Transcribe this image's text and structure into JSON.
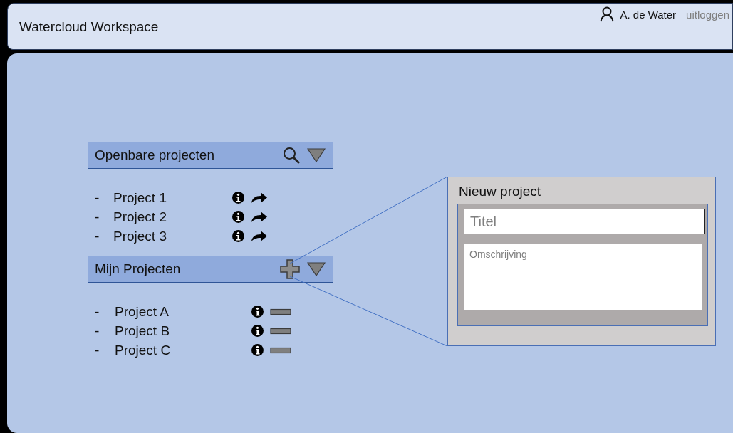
{
  "header": {
    "title": "Watercloud Workspace",
    "user": "A. de Water",
    "logout": "uitloggen"
  },
  "sections": [
    {
      "kind": "public",
      "title": "Openbare projecten",
      "items": [
        {
          "bullet": "-",
          "name": "Project 1"
        },
        {
          "bullet": "-",
          "name": "Project 2"
        },
        {
          "bullet": "-",
          "name": "Project 3"
        }
      ]
    },
    {
      "kind": "own",
      "title": "Mijn Projecten",
      "items": [
        {
          "bullet": "-",
          "name": "Project A"
        },
        {
          "bullet": "-",
          "name": "Project B"
        },
        {
          "bullet": "-",
          "name": "Project C"
        }
      ]
    }
  ],
  "new_project": {
    "title": "Nieuw project",
    "fields": [
      {
        "kind": "line",
        "placeholder": "Titel"
      },
      {
        "kind": "area",
        "placeholder": "Omschrijving"
      }
    ]
  }
}
